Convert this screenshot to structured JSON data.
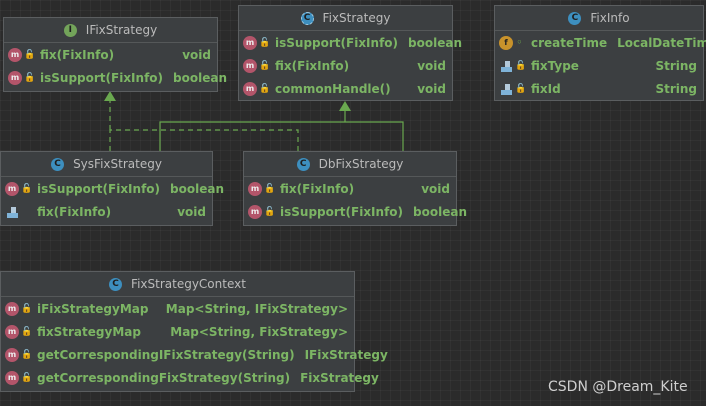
{
  "classes": {
    "ifix": {
      "title": "IFixStrategy",
      "kind": "interface",
      "members": [
        {
          "name": "fix(FixInfo)",
          "type": "void",
          "icon": "method"
        },
        {
          "name": "isSupport(FixInfo)",
          "type": "boolean",
          "icon": "method"
        }
      ]
    },
    "fix": {
      "title": "FixStrategy",
      "kind": "abstract-class",
      "members": [
        {
          "name": "isSupport(FixInfo)",
          "type": "boolean",
          "icon": "method"
        },
        {
          "name": "fix(FixInfo)",
          "type": "void",
          "icon": "method"
        },
        {
          "name": "commonHandle()",
          "type": "void",
          "icon": "method"
        }
      ]
    },
    "info": {
      "title": "FixInfo",
      "kind": "class",
      "members": [
        {
          "name": "createTime",
          "type": "LocalDateTime",
          "icon": "field"
        },
        {
          "name": "fixType",
          "type": "String",
          "icon": "property"
        },
        {
          "name": "fixId",
          "type": "String",
          "icon": "property"
        }
      ]
    },
    "sys": {
      "title": "SysFixStrategy",
      "kind": "class",
      "members": [
        {
          "name": "isSupport(FixInfo)",
          "type": "boolean",
          "icon": "method"
        },
        {
          "name": "fix(FixInfo)",
          "type": "void",
          "icon": "property"
        }
      ]
    },
    "db": {
      "title": "DbFixStrategy",
      "kind": "class",
      "members": [
        {
          "name": "fix(FixInfo)",
          "type": "void",
          "icon": "method"
        },
        {
          "name": "isSupport(FixInfo)",
          "type": "boolean",
          "icon": "method"
        }
      ]
    },
    "ctx": {
      "title": "FixStrategyContext",
      "kind": "class",
      "members": [
        {
          "name": "iFixStrategyMap",
          "type": "Map<String, IFixStrategy>",
          "icon": "method"
        },
        {
          "name": "fixStrategyMap",
          "type": "Map<String, FixStrategy>",
          "icon": "method"
        },
        {
          "name": "getCorrespondingIFixStrategy(String)",
          "type": "IFixStrategy",
          "icon": "method"
        },
        {
          "name": "getCorrespondingFixStrategy(String)",
          "type": "FixStrategy",
          "icon": "method"
        }
      ]
    }
  },
  "watermark": "CSDN @Dream_Kite",
  "colors": {
    "background": "#2b2b2b",
    "box": "#3c3f41",
    "member_text": "#7cb564",
    "edge": "#6aa84f"
  }
}
